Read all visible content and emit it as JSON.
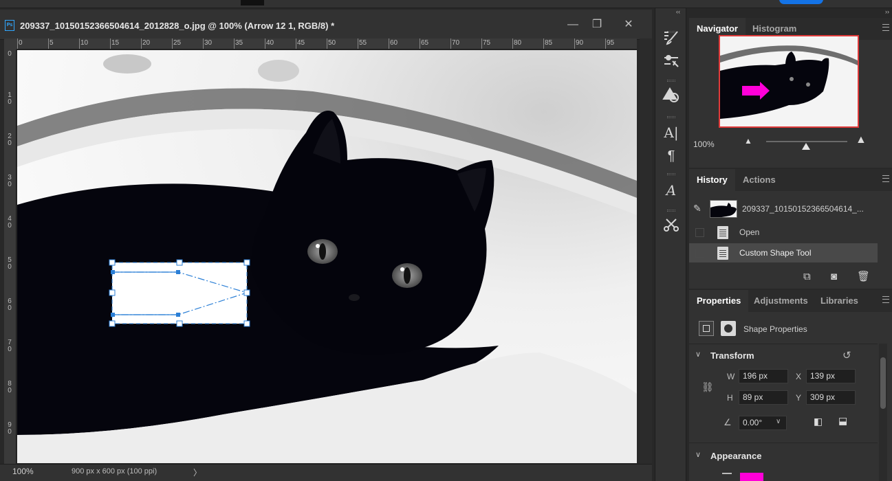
{
  "document": {
    "badge": "Ps",
    "title": "209337_10150152366504614_2012828_o.jpg @ 100% (Arrow 12 1, RGB/8) *",
    "minimize": "—",
    "restore": "❐",
    "close": "✕",
    "zoom": "100%",
    "info": "900 px x 600 px (100 ppi)",
    "info_arrow": "〉",
    "ruler_top": [
      "0",
      "5",
      "10",
      "15",
      "20",
      "25",
      "30",
      "35",
      "40",
      "45",
      "50",
      "55",
      "60",
      "65",
      "70",
      "75",
      "80",
      "85",
      "90",
      "95"
    ],
    "ruler_left": [
      "0",
      "1 0",
      "2 0",
      "3 0",
      "4 0",
      "5 0",
      "6 0",
      "7 0",
      "8 0",
      "9 0"
    ]
  },
  "toolbar": {
    "collapse_left": "‹‹",
    "collapse_right": "››"
  },
  "navigator": {
    "tabs": [
      "Navigator",
      "Histogram"
    ],
    "zoom": "100%"
  },
  "history": {
    "tabs": [
      "History",
      "Actions"
    ],
    "snapshot": "209337_10150152366504614_...",
    "items": [
      "Open",
      "Custom Shape Tool"
    ]
  },
  "properties": {
    "tabs": [
      "Properties",
      "Adjustments",
      "Libraries"
    ],
    "heading": "Shape Properties",
    "transform": {
      "title": "Transform",
      "w_label": "W",
      "w": "196 px",
      "x_label": "X",
      "x": "139 px",
      "h_label": "H",
      "h": "89 px",
      "y_label": "Y",
      "y": "309 px",
      "angle": "0.00°"
    },
    "appearance": {
      "title": "Appearance",
      "fill_color": "#ff00d8"
    }
  },
  "colors": {
    "accent": "#31a8ff",
    "selection": "#2b7fd6",
    "arrow_fill": "#ff00d8",
    "navigator_frame": "#e03a3a"
  }
}
